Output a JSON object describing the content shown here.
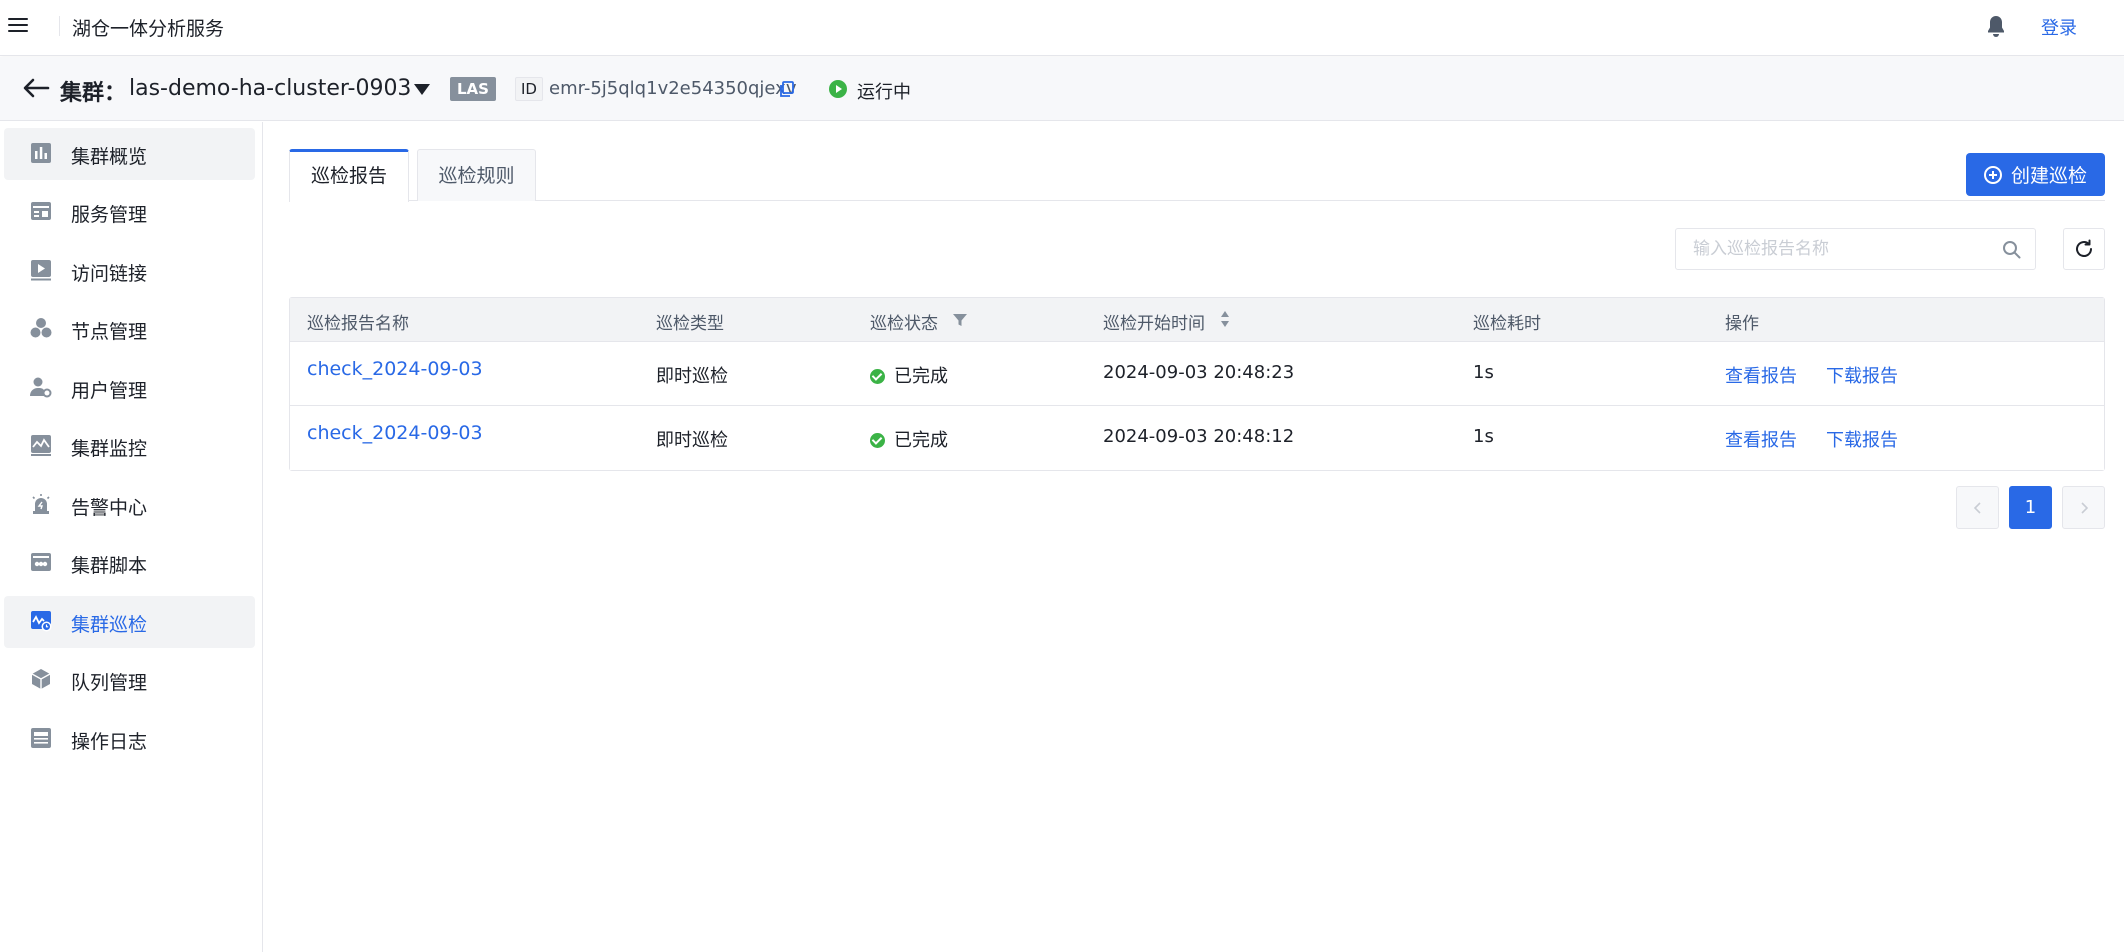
{
  "topbar": {
    "app_title": "湖仓一体分析服务",
    "login_label": "登录"
  },
  "cluster": {
    "label": "集群：",
    "name": "las-demo-ha-cluster-0903",
    "type_tag": "LAS",
    "id_label": "ID",
    "id_value": "emr-5j5qlq1v2e54350qjexv",
    "status": "运行中",
    "status_color": "#3bb346"
  },
  "sidebar": {
    "items": [
      {
        "label": "集群概览",
        "icon": "bar-chart-icon"
      },
      {
        "label": "服务管理",
        "icon": "service-grid-icon"
      },
      {
        "label": "访问链接",
        "icon": "link-play-icon"
      },
      {
        "label": "节点管理",
        "icon": "nodes-icon"
      },
      {
        "label": "用户管理",
        "icon": "user-settings-icon"
      },
      {
        "label": "集群监控",
        "icon": "monitor-chart-icon"
      },
      {
        "label": "告警中心",
        "icon": "alarm-light-icon"
      },
      {
        "label": "集群脚本",
        "icon": "script-icon"
      },
      {
        "label": "集群巡检",
        "icon": "inspection-icon"
      },
      {
        "label": "队列管理",
        "icon": "queue-cube-icon"
      },
      {
        "label": "操作日志",
        "icon": "log-icon"
      }
    ],
    "selected_index": 8
  },
  "main": {
    "tabs": [
      {
        "label": "巡检报告"
      },
      {
        "label": "巡检规则"
      }
    ],
    "create_button": "创建巡检",
    "search": {
      "placeholder": "输入巡检报告名称",
      "value": ""
    },
    "table": {
      "columns": [
        "巡检报告名称",
        "巡检类型",
        "巡检状态",
        "巡检开始时间",
        "巡检耗时",
        "操作"
      ],
      "rows": [
        {
          "name": "check_2024-09-03",
          "type": "即时巡检",
          "status": "已完成",
          "start_time": "2024-09-03 20:48:23",
          "duration": "1s",
          "action_view": "查看报告",
          "action_download": "下载报告"
        },
        {
          "name": "check_2024-09-03",
          "type": "即时巡检",
          "status": "已完成",
          "start_time": "2024-09-03 20:48:12",
          "duration": "1s",
          "action_view": "查看报告",
          "action_download": "下载报告"
        }
      ]
    },
    "pagination": {
      "current_page": "1"
    }
  },
  "colors": {
    "accent": "#2969e6",
    "success": "#3bb346"
  }
}
